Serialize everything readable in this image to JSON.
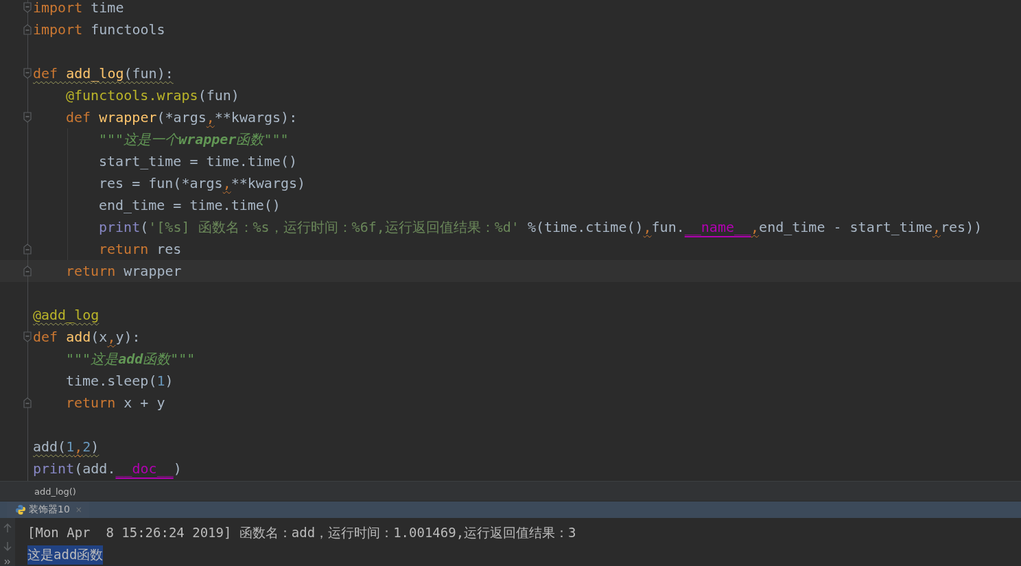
{
  "editor": {
    "lines": [
      {
        "kind": "code",
        "fold_start": true,
        "tokens": [
          {
            "kind": "keyword",
            "text": "import"
          },
          {
            "kind": "plain",
            "text": " time"
          }
        ]
      },
      {
        "kind": "code",
        "fold_end": true,
        "tokens": [
          {
            "kind": "keyword",
            "text": "import"
          },
          {
            "kind": "plain",
            "text": " functools"
          }
        ]
      },
      {
        "kind": "blank"
      },
      {
        "kind": "code",
        "fold_start": true,
        "warning": true,
        "tokens": [
          {
            "kind": "keyword",
            "text": "def "
          },
          {
            "kind": "function",
            "text": "add_log"
          },
          {
            "kind": "plain",
            "text": "(fun):"
          }
        ],
        "children": [
          {
            "kind": "code",
            "tokens": [
              {
                "kind": "decorator",
                "text": "@functools.wraps"
              },
              {
                "kind": "plain",
                "text": "(fun)"
              }
            ]
          },
          {
            "kind": "code",
            "fold_start": true,
            "tokens": [
              {
                "kind": "keyword",
                "text": "def "
              },
              {
                "kind": "function",
                "text": "wrapper"
              },
              {
                "kind": "plain",
                "text": "(*args"
              },
              {
                "kind": "warn",
                "text": ","
              },
              {
                "kind": "plain",
                "text": "**kwargs):"
              }
            ],
            "children": [
              {
                "kind": "code",
                "tokens": [
                  {
                    "kind": "docstring",
                    "text": "\"\"\"这是一个**wrapper**函数\"\"\""
                  }
                ]
              },
              {
                "kind": "code",
                "tokens": [
                  {
                    "kind": "plain",
                    "text": "start_time = time.time()"
                  }
                ]
              },
              {
                "kind": "code",
                "tokens": [
                  {
                    "kind": "plain",
                    "text": "res = fun(*args"
                  },
                  {
                    "kind": "warn",
                    "text": ","
                  },
                  {
                    "kind": "plain",
                    "text": "**kwargs)"
                  }
                ]
              },
              {
                "kind": "code",
                "tokens": [
                  {
                    "kind": "plain",
                    "text": "end_time = time.time()"
                  }
                ]
              },
              {
                "kind": "code",
                "tokens": [
                  {
                    "kind": "builtin",
                    "text": "print"
                  },
                  {
                    "kind": "plain",
                    "text": "("
                  },
                  {
                    "kind": "string",
                    "text": "'[%s] 函数名：%s，运行时间：%6f,运行返回值结果：%d'"
                  },
                  {
                    "kind": "plain",
                    "text": " %(time.ctime()"
                  },
                  {
                    "kind": "warn",
                    "text": ","
                  },
                  {
                    "kind": "plain",
                    "text": "fun."
                  },
                  {
                    "kind": "magic",
                    "text": "__name__"
                  },
                  {
                    "kind": "warn",
                    "text": ","
                  },
                  {
                    "kind": "plain",
                    "text": "end_time - start_time"
                  },
                  {
                    "kind": "warn",
                    "text": ","
                  },
                  {
                    "kind": "plain",
                    "text": "res))"
                  }
                ]
              },
              {
                "kind": "code",
                "fold_end": true,
                "tokens": [
                  {
                    "kind": "keyword",
                    "text": "return"
                  },
                  {
                    "kind": "plain",
                    "text": " res"
                  }
                ]
              }
            ]
          },
          {
            "kind": "code",
            "fold_end": true,
            "current": true,
            "tokens": [
              {
                "kind": "keyword",
                "text": "return"
              },
              {
                "kind": "plain",
                "text": " wrapper"
              }
            ]
          }
        ]
      },
      {
        "kind": "blank"
      },
      {
        "kind": "code",
        "warning": true,
        "tokens": [
          {
            "kind": "decorator",
            "text": "@add_log"
          }
        ]
      },
      {
        "kind": "code",
        "fold_start": true,
        "tokens": [
          {
            "kind": "keyword",
            "text": "def "
          },
          {
            "kind": "function",
            "text": "add"
          },
          {
            "kind": "plain",
            "text": "(x"
          },
          {
            "kind": "warn",
            "text": ","
          },
          {
            "kind": "plain",
            "text": "y):"
          }
        ],
        "children": [
          {
            "kind": "code",
            "tokens": [
              {
                "kind": "docstring",
                "text": "\"\"\"这是**add**函数\"\"\""
              }
            ]
          },
          {
            "kind": "code",
            "tokens": [
              {
                "kind": "plain",
                "text": "time.sleep("
              },
              {
                "kind": "number",
                "text": "1"
              },
              {
                "kind": "plain",
                "text": ")"
              }
            ]
          },
          {
            "kind": "code",
            "fold_end": true,
            "tokens": [
              {
                "kind": "keyword",
                "text": "return"
              },
              {
                "kind": "plain",
                "text": " x + y"
              }
            ]
          }
        ]
      },
      {
        "kind": "blank"
      },
      {
        "kind": "code",
        "warning": true,
        "tokens": [
          {
            "kind": "plain",
            "text": "add("
          },
          {
            "kind": "number",
            "text": "1"
          },
          {
            "kind": "warn",
            "text": ","
          },
          {
            "kind": "number",
            "text": "2"
          },
          {
            "kind": "plain",
            "text": ")"
          }
        ]
      },
      {
        "kind": "code",
        "tokens": [
          {
            "kind": "builtin",
            "text": "print"
          },
          {
            "kind": "plain",
            "text": "(add."
          },
          {
            "kind": "magic",
            "text": "__doc__"
          },
          {
            "kind": "plain",
            "text": ")"
          }
        ]
      }
    ]
  },
  "breadcrumb": "add_log()",
  "run_tab": {
    "label": "装饰器10",
    "close": "×"
  },
  "console": {
    "lines": [
      {
        "text": "[Mon Apr  8 15:26:24 2019] 函数名：add，运行时间：1.001469,运行返回值结果：3",
        "selected": false
      },
      {
        "text": "这是add函数",
        "selected": true
      }
    ]
  }
}
